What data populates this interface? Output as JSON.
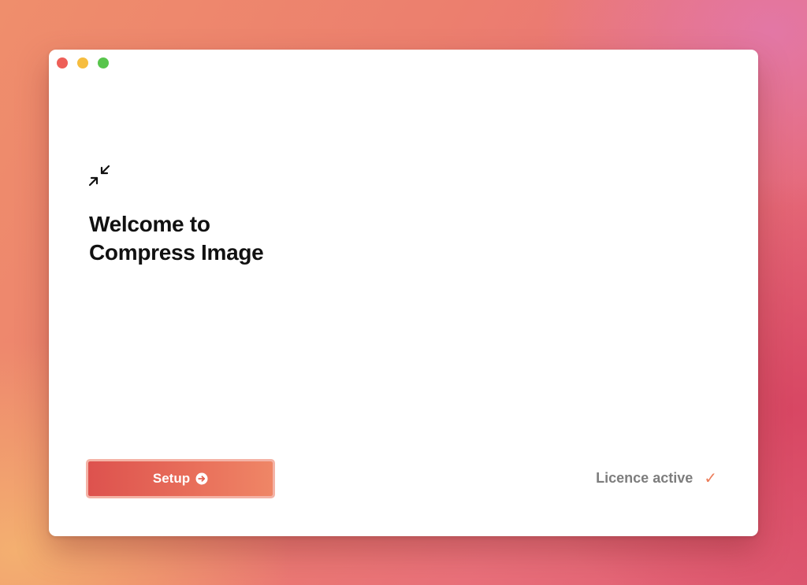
{
  "window": {
    "controls": [
      "close",
      "minimize",
      "maximize"
    ]
  },
  "app": {
    "icon": "compress-arrows-icon",
    "title_line1": "Welcome to",
    "title_line2": "Compress Image"
  },
  "setup": {
    "label": "Setup",
    "icon": "arrow-right-circle-icon",
    "gradient_start": "#dd524e",
    "gradient_end": "#ef8666"
  },
  "licence": {
    "status_text": "Licence active",
    "icon": "check-icon",
    "icon_glyph": "✓",
    "accent": "#ec7d5a"
  }
}
